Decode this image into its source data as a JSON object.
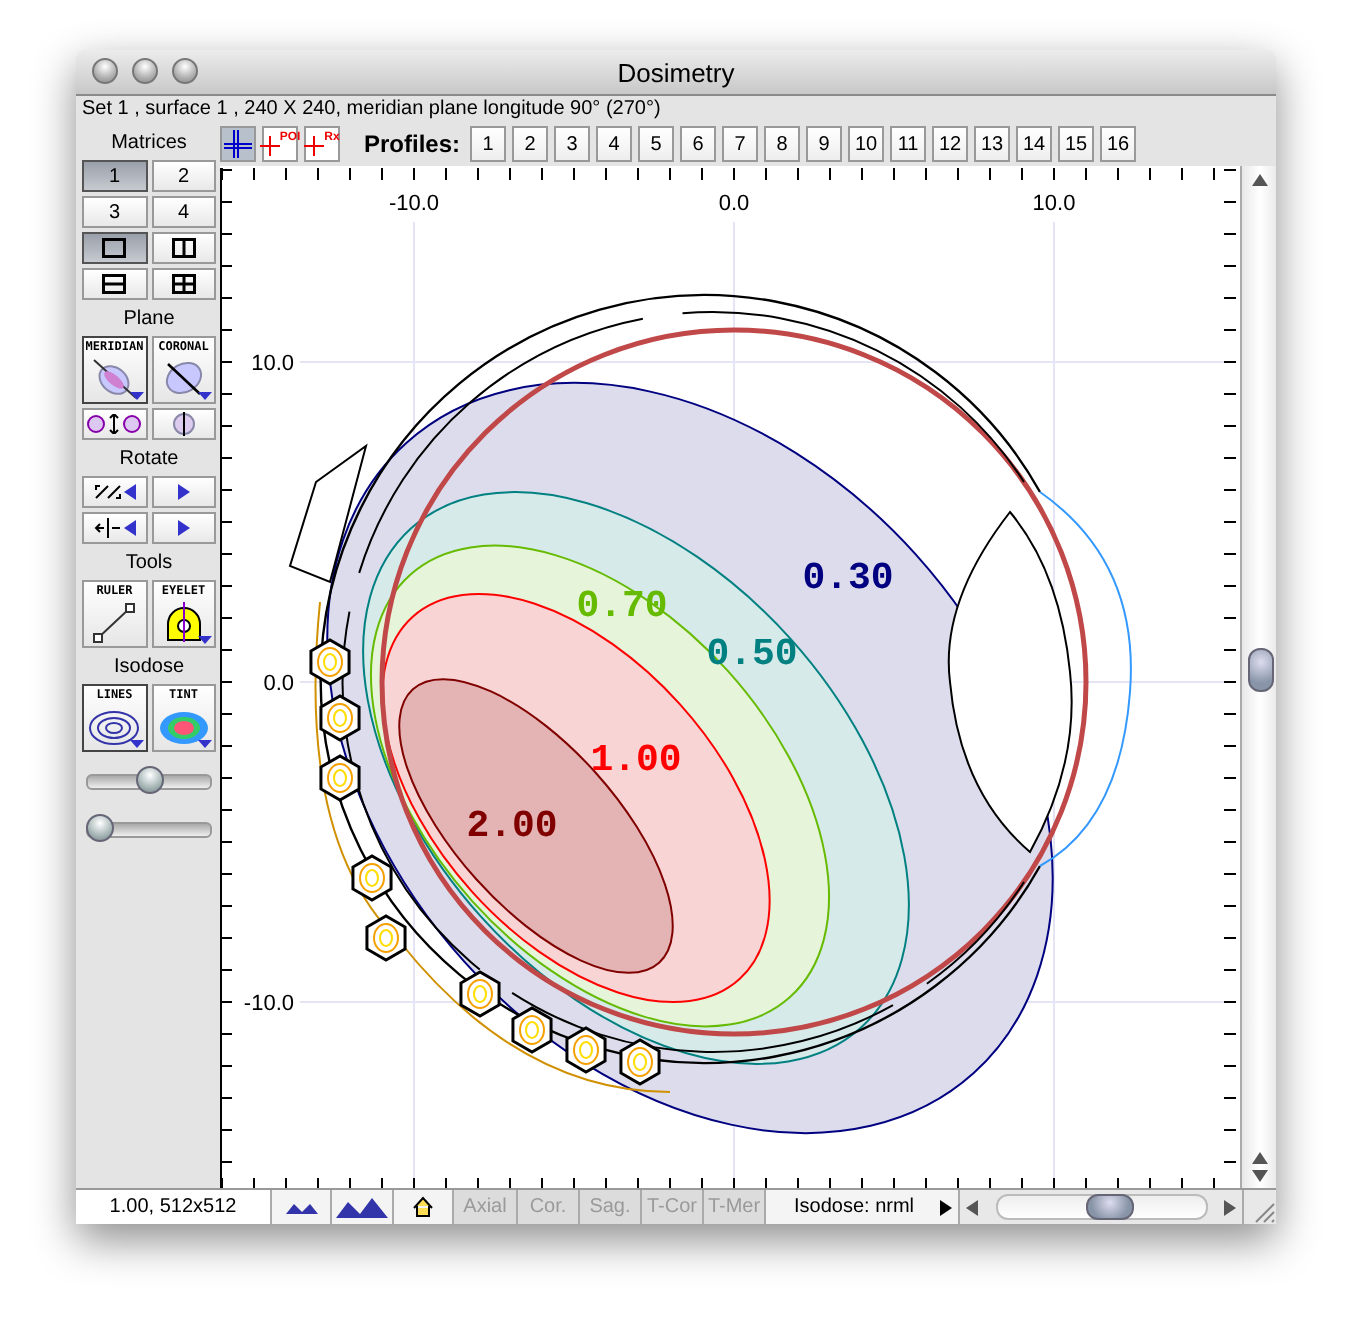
{
  "window": {
    "title": "Dosimetry"
  },
  "info_line": "Set 1 , surface 1 , 240 X 240, meridian plane longitude 90° (270°)",
  "toolbar": {
    "view_tools": [
      {
        "kind": "cross",
        "selected": true
      },
      {
        "kind": "poi",
        "label": "POI",
        "selected": false
      },
      {
        "kind": "rx",
        "label": "Rx",
        "selected": false
      }
    ],
    "profiles_label": "Profiles:",
    "profiles": [
      "1",
      "2",
      "3",
      "4",
      "5",
      "6",
      "7",
      "8",
      "9",
      "10",
      "11",
      "12",
      "13",
      "14",
      "15",
      "16"
    ]
  },
  "matrices": {
    "title": "Matrices",
    "numbers": [
      {
        "label": "1",
        "selected": true
      },
      {
        "label": "2",
        "selected": false
      },
      {
        "label": "3",
        "selected": false
      },
      {
        "label": "4",
        "selected": false
      }
    ],
    "layouts": [
      {
        "kind": "single",
        "selected": true
      },
      {
        "kind": "vsplit",
        "selected": false
      },
      {
        "kind": "hsplit",
        "selected": false
      },
      {
        "kind": "quad",
        "selected": false
      }
    ]
  },
  "plane": {
    "title": "Plane",
    "buttons": [
      {
        "label": "MERIDIAN",
        "kind": "meridian",
        "selected": true
      },
      {
        "label": "CORONAL",
        "kind": "coronal",
        "selected": false
      }
    ],
    "tools": [
      {
        "kind": "swap"
      },
      {
        "kind": "cut"
      }
    ]
  },
  "rotate": {
    "title": "Rotate",
    "buttons": [
      {
        "kind": "rotate"
      },
      {
        "kind": "play"
      },
      {
        "kind": "flip"
      },
      {
        "kind": "play"
      }
    ]
  },
  "tools": {
    "title": "Tools",
    "buttons": [
      {
        "label": "RULER",
        "kind": "ruler"
      },
      {
        "label": "EYELET",
        "kind": "eyelet"
      }
    ]
  },
  "isodose": {
    "title": "Isodose",
    "buttons": [
      {
        "label": "LINES",
        "kind": "lines",
        "selected": true
      },
      {
        "label": "TINT",
        "kind": "tint",
        "selected": false
      }
    ],
    "sliders": [
      {
        "level": 0.5
      },
      {
        "level": 0.1
      }
    ]
  },
  "plot": {
    "x_labels": [
      "-10.0",
      "0.0",
      "10.0"
    ],
    "y_labels": [
      "10.0",
      "0.0",
      "-10.0"
    ],
    "isodose_labels": [
      {
        "text": "0.30",
        "color": "#000080"
      },
      {
        "text": "0.50",
        "color": "#008080"
      },
      {
        "text": "0.70",
        "color": "#66bb00"
      },
      {
        "text": "1.00",
        "color": "#ff0000"
      },
      {
        "text": "2.00",
        "color": "#800000"
      }
    ]
  },
  "status_bar": {
    "zoom": "1.00, 512x512",
    "tools": [
      {
        "kind": "small-peaks"
      },
      {
        "kind": "large-peaks"
      },
      {
        "kind": "home"
      }
    ],
    "views": [
      {
        "label": "Axial",
        "disabled": true
      },
      {
        "label": "Cor.",
        "disabled": true
      },
      {
        "label": "Sag.",
        "disabled": true
      },
      {
        "label": "T-Cor",
        "disabled": true
      },
      {
        "label": "T-Mer",
        "disabled": true
      }
    ],
    "isodose_menu": "Isodose: nrml"
  }
}
